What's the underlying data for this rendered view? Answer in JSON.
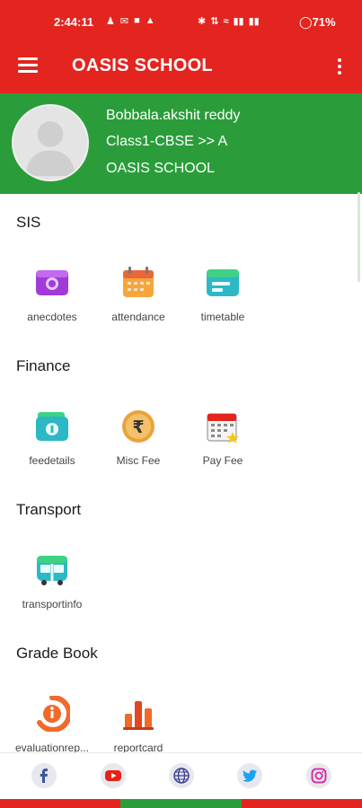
{
  "status": {
    "time": "2:44:11",
    "battery": "71%"
  },
  "appbar": {
    "title": "OASIS SCHOOL"
  },
  "profile": {
    "name": "Bobbala.akshit reddy",
    "class": "Class1-CBSE >> A",
    "school": "OASIS SCHOOL"
  },
  "sections": {
    "sis": {
      "title": "SIS",
      "items": [
        "anecdotes",
        "attendance",
        "timetable"
      ]
    },
    "finance": {
      "title": "Finance",
      "items": [
        "feedetails",
        "Misc Fee",
        "Pay Fee"
      ]
    },
    "transport": {
      "title": "Transport",
      "items": [
        "transportinfo"
      ]
    },
    "gradebook": {
      "title": "Grade Book",
      "items": [
        "evaluationrep...",
        "reportcard"
      ]
    }
  },
  "bottom_nav": {
    "icons": [
      "facebook-icon",
      "youtube-icon",
      "globe-icon",
      "twitter-icon",
      "instagram-icon"
    ]
  },
  "colors": {
    "brand_red": "#e3241f",
    "profile_green": "#2a9d3a"
  }
}
